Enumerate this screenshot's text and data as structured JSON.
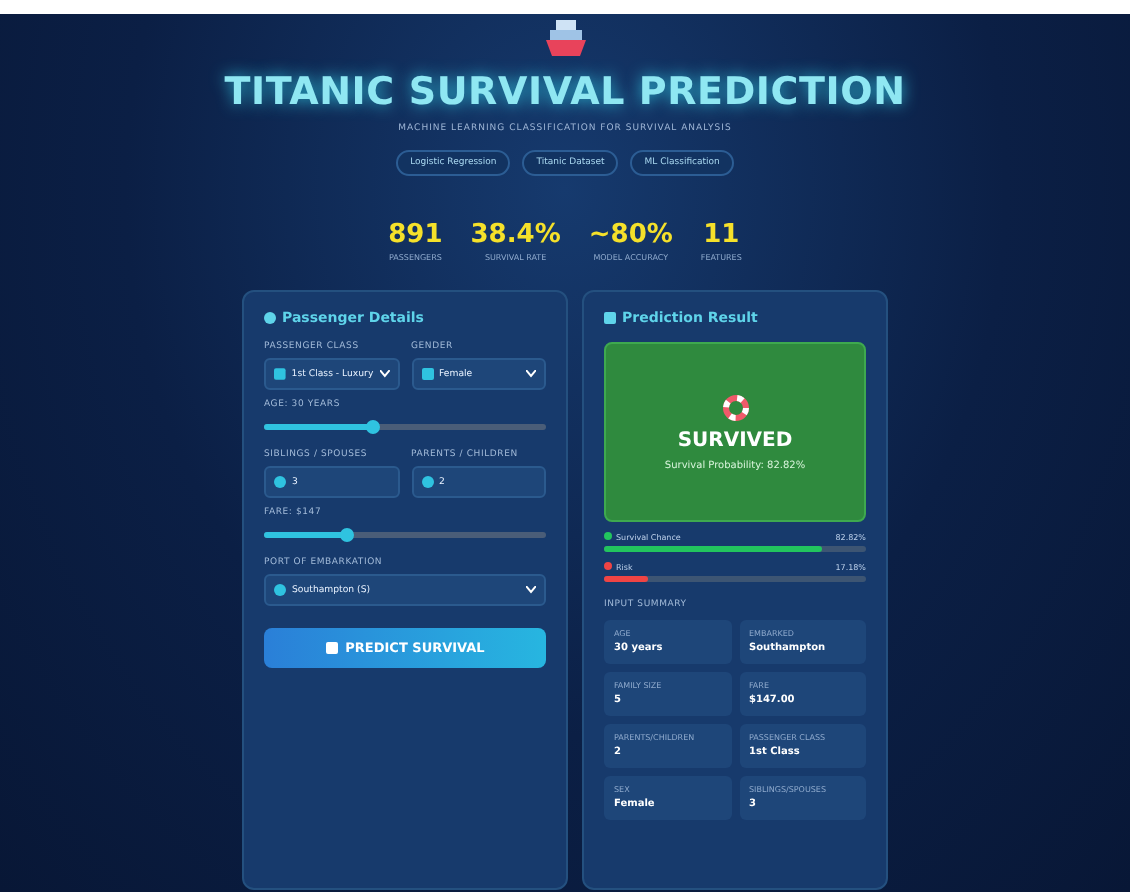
{
  "header": {
    "title": "TITANIC SURVIVAL PREDICTION",
    "subtitle": "MACHINE LEARNING CLASSIFICATION FOR SURVIVAL ANALYSIS",
    "badges": [
      "Logistic Regression",
      "Titanic Dataset",
      "ML Classification"
    ]
  },
  "stats": [
    {
      "value": "891",
      "label": "PASSENGERS"
    },
    {
      "value": "38.4%",
      "label": "SURVIVAL RATE"
    },
    {
      "value": "~80%",
      "label": "MODEL ACCURACY"
    },
    {
      "value": "11",
      "label": "FEATURES"
    }
  ],
  "form": {
    "title": "Passenger Details",
    "class_field": {
      "label": "PASSENGER CLASS",
      "value": "1st Class - Luxury"
    },
    "sex_field": {
      "label": "GENDER",
      "value": "Female"
    },
    "age": {
      "label": "AGE: 30 YEARS",
      "level": 0.38
    },
    "siblings": {
      "label": "SIBLINGS / SPOUSES",
      "value": "3"
    },
    "parents": {
      "label": "PARENTS / CHILDREN",
      "value": "2"
    },
    "fare": {
      "label": "FARE: $147",
      "level": 0.29
    },
    "port": {
      "label": "PORT OF EMBARKATION",
      "value": "Southampton (S)"
    },
    "button": "PREDICT SURVIVAL"
  },
  "result": {
    "title": "Prediction Result",
    "outcome": "SURVIVED",
    "probability": "Survival Probability: 82.82%",
    "bars": [
      {
        "label": "Survival Chance",
        "reading": "82.82%",
        "level": 0.83,
        "color": "#22c55e"
      },
      {
        "label": "Risk",
        "reading": "17.18%",
        "level": 0.17,
        "color": "#ef4444"
      }
    ],
    "summary_title": "INPUT SUMMARY",
    "summary": [
      {
        "label": "AGE",
        "value": "30 years"
      },
      {
        "label": "EMBARKED",
        "value": "Southampton"
      },
      {
        "label": "FAMILY SIZE",
        "value": "5"
      },
      {
        "label": "FARE",
        "value": "$147.00"
      },
      {
        "label": "PARENTS/CHILDREN",
        "value": "2"
      },
      {
        "label": "PASSENGER CLASS",
        "value": "1st Class"
      },
      {
        "label": "SEX",
        "value": "Female"
      },
      {
        "label": "SIBLINGS/SPOUSES",
        "value": "3"
      }
    ]
  }
}
